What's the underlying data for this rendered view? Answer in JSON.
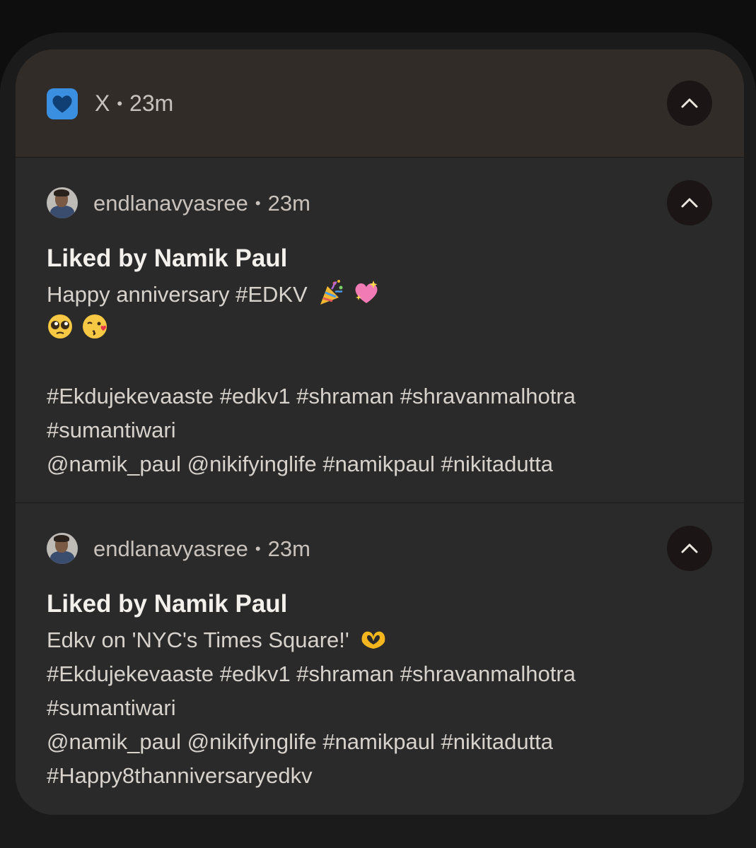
{
  "group": {
    "app_name": "X",
    "separator": "•",
    "time": "23m",
    "icon": "heart-icon"
  },
  "notifications": [
    {
      "author": "endlanavyasree",
      "separator": "•",
      "time": "23m",
      "title": "Liked by Namik Paul",
      "lines": [
        "Happy anniversary #EDKV",
        "",
        "",
        "#Ekdujekevaaste #edkv1 #shraman #shravanmalhotra",
        "#sumantiwari",
        "@namik_paul @nikifyinglife #namikpaul #nikitadutta"
      ],
      "emojis": [
        "party-popper-emoji",
        "sparkling-heart-emoji",
        "pleading-face-emoji",
        "face-blowing-kiss-emoji"
      ]
    },
    {
      "author": "endlanavyasree",
      "separator": "•",
      "time": "23m",
      "title": "Liked by Namik Paul",
      "lines": [
        "Edkv on 'NYC's Times Square!'",
        "#Ekdujekevaaste #edkv1 #shraman #shravanmalhotra",
        "#sumantiwari",
        "@namik_paul @nikifyinglife #namikpaul #nikitadutta",
        "#Happy8thanniversaryedkv"
      ],
      "emojis": [
        "heart-hands-emoji"
      ]
    }
  ],
  "colors": {
    "header_bg": "#322c29",
    "card_bg": "#2a2a2a",
    "icon_blue": "#3a8fe0",
    "title_text": "#f4f0ec",
    "body_text": "#d8d2cc",
    "button_bg": "#1b1615"
  }
}
